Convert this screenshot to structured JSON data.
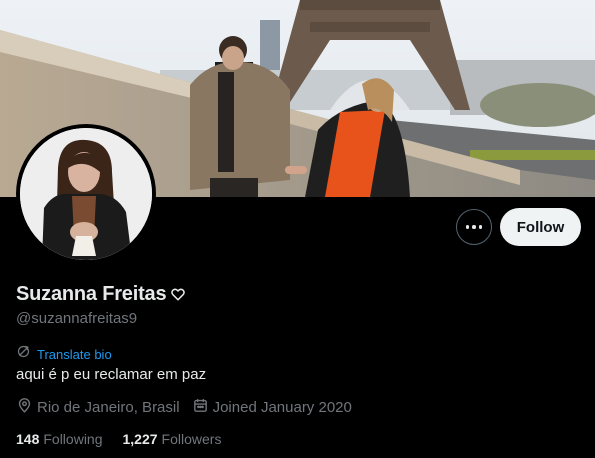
{
  "profile": {
    "display_name": "Suzanna Freitas",
    "handle": "@suzannafreitas9",
    "translate_label": "Translate bio",
    "bio": "aqui é p eu reclamar em paz",
    "location": "Rio de Janeiro, Brasil",
    "joined": "Joined January 2020"
  },
  "stats": {
    "following_count": "148",
    "following_label": "Following",
    "followers_count": "1,227",
    "followers_label": "Followers"
  },
  "actions": {
    "follow_label": "Follow"
  },
  "icons": {
    "name_badge": "heart-outline-icon",
    "translate": "translate-icon",
    "location": "location-pin-icon",
    "joined": "calendar-icon",
    "more": "more-dots-icon"
  },
  "colors": {
    "background": "#000000",
    "primary_text": "#e7e9ea",
    "secondary_text": "#71767b",
    "link": "#1d9bf0",
    "follow_button_bg": "#eff3f4",
    "follow_button_text": "#0f1419",
    "border": "#536471"
  }
}
